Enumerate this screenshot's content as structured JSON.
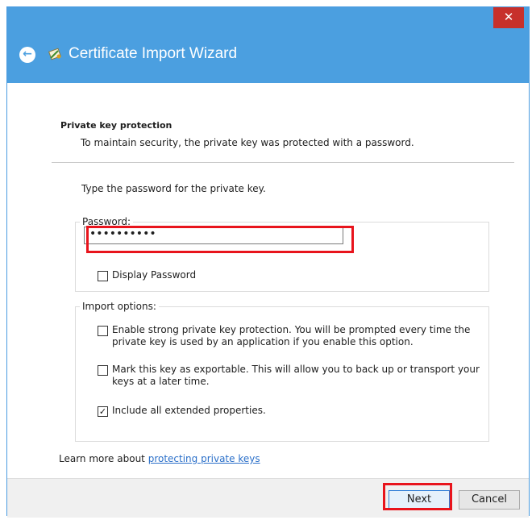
{
  "window": {
    "title": "Certificate Import Wizard",
    "close_glyph": "✕",
    "back_glyph": "←"
  },
  "section": {
    "title": "Private key protection",
    "subtitle": "To maintain security, the private key was protected with a password."
  },
  "prompt": "Type the password for the private key.",
  "password": {
    "label": "Password:",
    "value": "••••••••••",
    "display_label": "Display Password",
    "display_checked": false
  },
  "import_options": {
    "label": "Import options:",
    "items": [
      {
        "label_line1": "Enable strong private key protection. You will be prompted every time the",
        "label_line2": "private key is used by an application if you enable this option.",
        "checked": false
      },
      {
        "label_line1": "Mark this key as exportable. This will allow you to back up or transport your",
        "label_line2": "keys at a later time.",
        "checked": false
      },
      {
        "label_line1": "Include all extended properties.",
        "label_line2": "",
        "checked": true
      }
    ]
  },
  "learn_more": {
    "prefix": "Learn more about ",
    "link": "protecting private keys"
  },
  "buttons": {
    "next": "Next",
    "cancel": "Cancel"
  },
  "check_glyph": "✓",
  "colors": {
    "titlebar": "#4b9fe0",
    "close": "#c7302b",
    "highlight": "#e8141c",
    "link": "#2a6fc9"
  },
  "icons": [
    "back-arrow-icon",
    "certificate-wizard-icon",
    "close-icon",
    "checkbox-icon"
  ]
}
